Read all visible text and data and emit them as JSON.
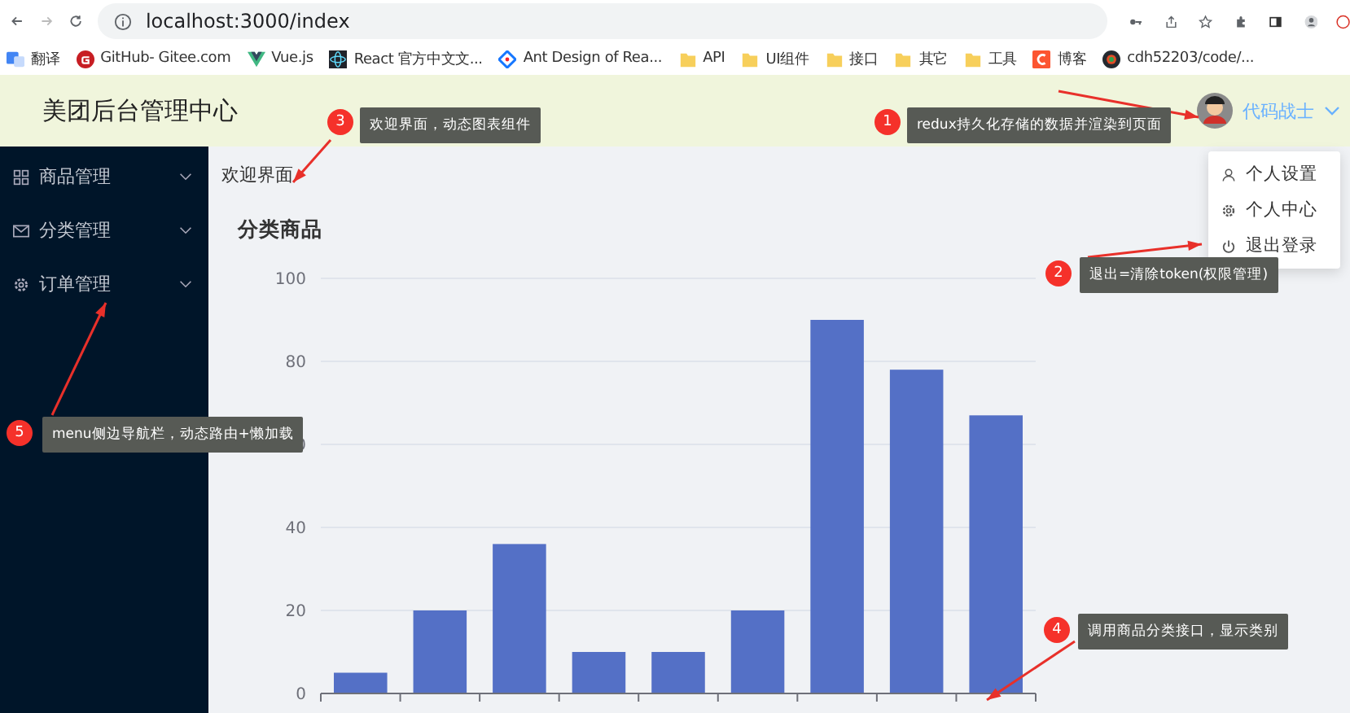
{
  "browser": {
    "url": "localhost:3000/index",
    "bookmarks": [
      {
        "label": "翻译",
        "kind": "translate"
      },
      {
        "label": "GitHub- Gitee.com",
        "kind": "gitee"
      },
      {
        "label": "Vue.js",
        "kind": "vue"
      },
      {
        "label": "React 官方中文文...",
        "kind": "react"
      },
      {
        "label": "Ant Design of Rea...",
        "kind": "antd"
      },
      {
        "label": "API",
        "kind": "folder"
      },
      {
        "label": "UI组件",
        "kind": "folder"
      },
      {
        "label": "接口",
        "kind": "folder"
      },
      {
        "label": "其它",
        "kind": "folder"
      },
      {
        "label": "工具",
        "kind": "folder"
      },
      {
        "label": "博客",
        "kind": "csdn"
      },
      {
        "label": "cdh52203/code/...",
        "kind": "github"
      }
    ]
  },
  "header": {
    "title": "美团后台管理中心",
    "user": {
      "name": "代码战士"
    }
  },
  "sidebar": {
    "items": [
      {
        "label": "商品管理",
        "kind": "grid"
      },
      {
        "label": "分类管理",
        "kind": "mail"
      },
      {
        "label": "订单管理",
        "kind": "gear"
      }
    ]
  },
  "breadcrumb": "欢迎界面",
  "chart_title": "分类商品",
  "chart_data": {
    "type": "bar",
    "values": [
      5,
      20,
      36,
      10,
      10,
      20,
      90,
      78,
      67
    ],
    "ylim": [
      0,
      100
    ],
    "yticks": [
      0,
      20,
      40,
      60,
      80,
      100
    ],
    "grid": true
  },
  "user_menu": {
    "items": [
      {
        "label": "个人设置",
        "kind": "user"
      },
      {
        "label": "个人中心",
        "kind": "gear"
      },
      {
        "label": "退出登录",
        "kind": "power"
      }
    ]
  },
  "annotations": [
    {
      "number": "1",
      "text": "redux持久化存储的数据并渲染到页面"
    },
    {
      "number": "2",
      "text": "退出=清除token(权限管理)"
    },
    {
      "number": "3",
      "text": "欢迎界面，动态图表组件"
    },
    {
      "number": "4",
      "text": "调用商品分类接口，显示类别"
    },
    {
      "number": "5",
      "text": "menu侧边导航栏，动态路由+懒加载"
    }
  ]
}
